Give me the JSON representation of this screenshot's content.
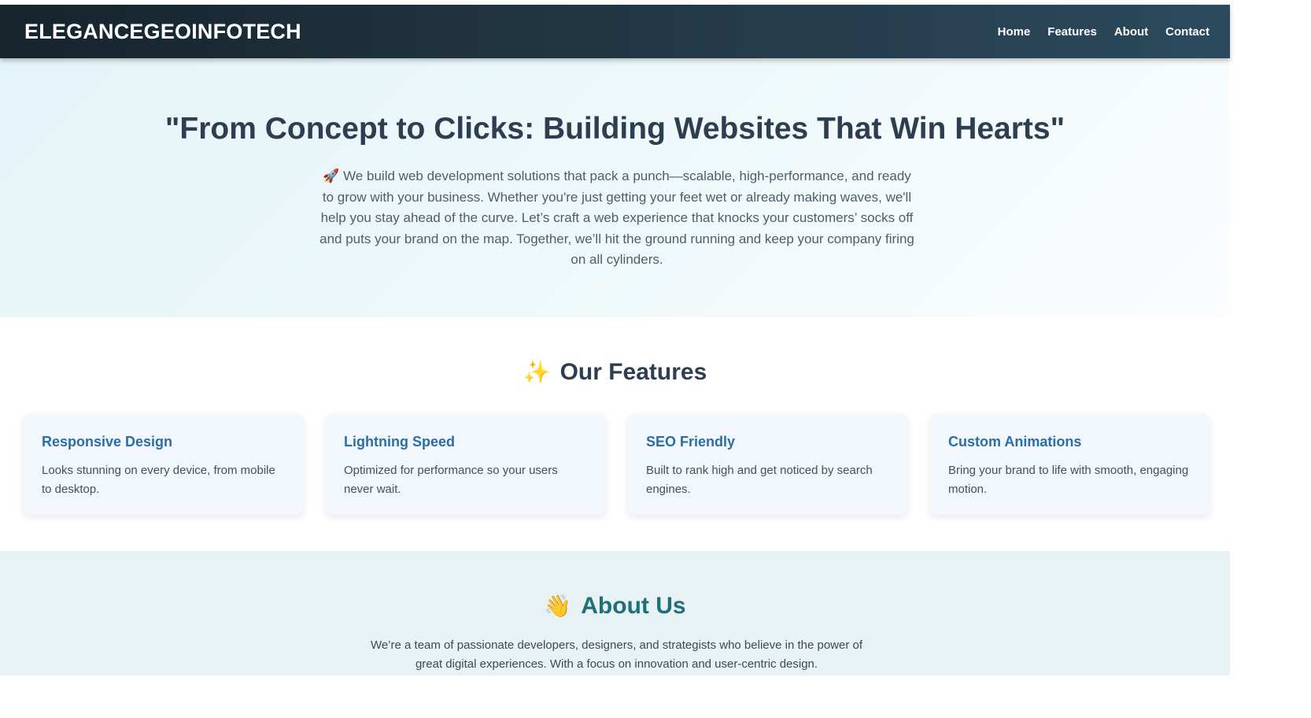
{
  "navbar": {
    "brand": "ELEGANCEGEOINFOTECH",
    "links": [
      "Home",
      "Features",
      "About",
      "Contact"
    ]
  },
  "hero": {
    "title": "\"From Concept to Clicks: Building Websites That Win Hearts\"",
    "text": "🚀 We build web development solutions that pack a punch—scalable, high-performance, and ready to grow with your business. Whether you're just getting your feet wet or already making waves, we'll help you stay ahead of the curve. Let’s craft a web experience that knocks your customers’ socks off and puts your brand on the map. Together, we’ll hit the ground running and keep your company firing on all cylinders."
  },
  "features": {
    "emoji": "✨",
    "title": "Our Features",
    "cards": [
      {
        "title": "Responsive Design",
        "text": "Looks stunning on every device, from mobile to desktop."
      },
      {
        "title": "Lightning Speed",
        "text": "Optimized for performance so your users never wait."
      },
      {
        "title": "SEO Friendly",
        "text": "Built to rank high and get noticed by search engines."
      },
      {
        "title": "Custom Animations",
        "text": "Bring your brand to life with smooth, engaging motion."
      }
    ]
  },
  "about": {
    "emoji": "👋",
    "title": "About Us",
    "text": "We’re a team of passionate developers, designers, and strategists who believe in the power of great digital experiences. With a focus on innovation and user-centric design."
  }
}
